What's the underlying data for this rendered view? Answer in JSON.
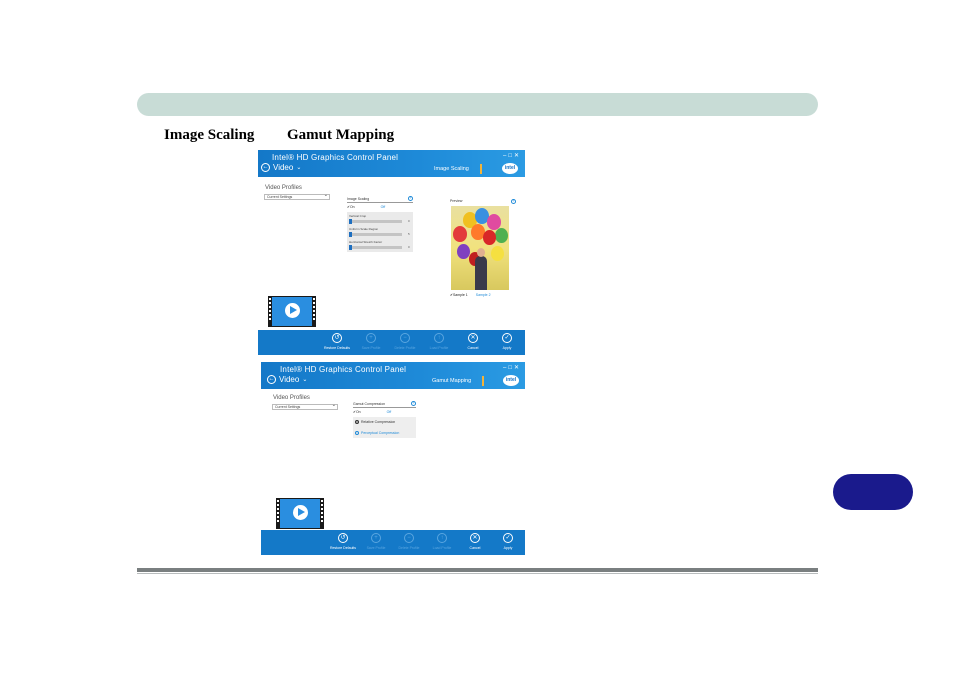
{
  "headings": {
    "left": "Image Scaling",
    "right": "Gamut Mapping"
  },
  "app": {
    "title": "Intel® HD Graphics Control Panel",
    "nav": "Video"
  },
  "panel1": {
    "section": "Image Scaling",
    "video_profiles": "Video Profiles",
    "profile_value": "Current Settings",
    "group_title": "Image Scaling",
    "on_label": "On",
    "off_label": "Off",
    "sliders": [
      {
        "label": "Vertical Crop",
        "value": "0"
      },
      {
        "label": "Uniform Scale Region",
        "value": "5"
      },
      {
        "label": "Horizontal Stretch Factor",
        "value": "0"
      }
    ],
    "preview_title": "Preview",
    "sample1": "Sample 1",
    "sample2": "Sample 2"
  },
  "panel2": {
    "section": "Gamut Mapping",
    "video_profiles": "Video Profiles",
    "profile_value": "Current Settings",
    "group_title": "Gamut Compression",
    "on_label": "On",
    "off_label": "Off",
    "radio_selected": "Relative Compression",
    "radio_other": "Perceptual Compression"
  },
  "footer": {
    "restore": "Restore Defaults",
    "save_profile": "Save Profile",
    "delete_profile": "Delete Profile",
    "load_profile": "Load Profile",
    "cancel": "Cancel",
    "apply": "Apply"
  }
}
